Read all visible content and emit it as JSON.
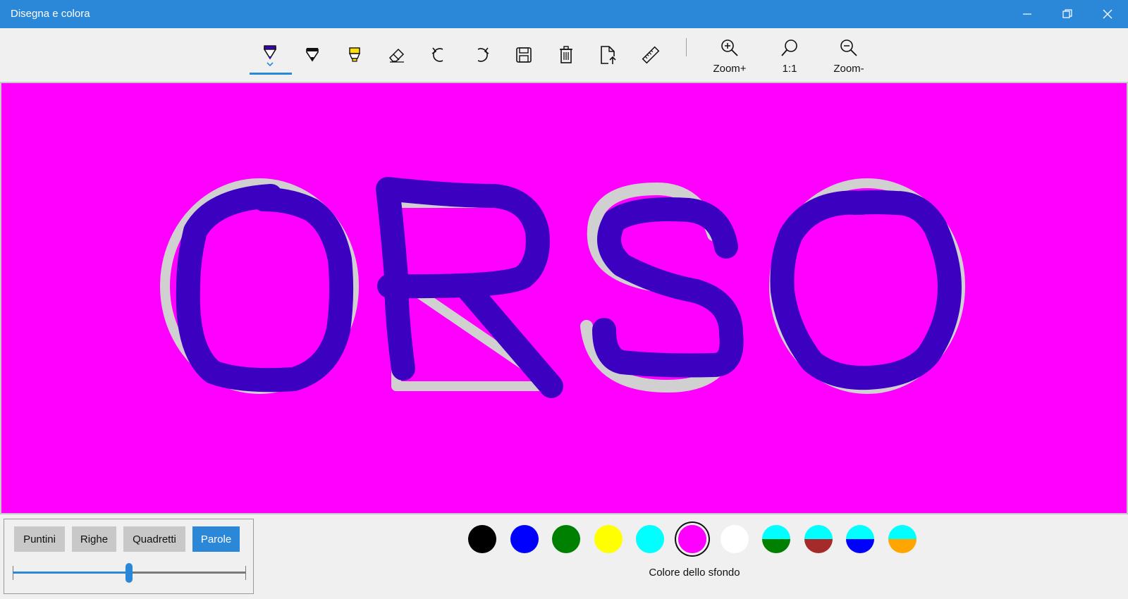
{
  "window": {
    "title": "Disegna e colora"
  },
  "toolbar": {
    "tools": [
      "pen-tool",
      "marker-tool",
      "highlighter-tool",
      "eraser-tool",
      "undo",
      "redo",
      "save",
      "delete",
      "export",
      "ruler"
    ],
    "zoom_in_label": "Zoom+",
    "zoom_reset_label": "1:1",
    "zoom_out_label": "Zoom-"
  },
  "canvas": {
    "background_color": "#ff00ff",
    "stroke_color": "#3b00c0",
    "guide_color": "#d0d0d0",
    "word": "ORSO"
  },
  "modes": {
    "buttons": [
      "Puntini",
      "Righe",
      "Quadretti",
      "Parole"
    ],
    "selected": "Parole",
    "slider_value": 0.5
  },
  "palette": {
    "colors": [
      {
        "top": "#000000",
        "bottom": "#000000"
      },
      {
        "top": "#0000ff",
        "bottom": "#0000ff"
      },
      {
        "top": "#008000",
        "bottom": "#008000"
      },
      {
        "top": "#ffff00",
        "bottom": "#ffff00"
      },
      {
        "top": "#00ffff",
        "bottom": "#00ffff"
      },
      {
        "top": "#ff00ff",
        "bottom": "#ff00ff"
      },
      {
        "top": "#ffffff",
        "bottom": "#ffffff"
      },
      {
        "top": "#00ffff",
        "bottom": "#008000"
      },
      {
        "top": "#00ffff",
        "bottom": "#a52a2a"
      },
      {
        "top": "#00ffff",
        "bottom": "#0000ff"
      },
      {
        "top": "#00ffff",
        "bottom": "#ffa500"
      }
    ],
    "selected_index": 5,
    "label": "Colore dello sfondo"
  }
}
